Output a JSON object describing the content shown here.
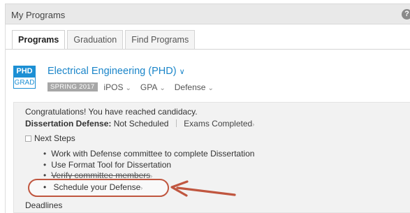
{
  "panel": {
    "title": "My Programs",
    "help_icon": "?"
  },
  "tabs": [
    {
      "label": "Programs",
      "active": true
    },
    {
      "label": "Graduation",
      "active": false
    },
    {
      "label": "Find Programs",
      "active": false
    }
  ],
  "program": {
    "badge_top": "PHD",
    "badge_bottom": "GRAD",
    "title": "Electrical Engineering (PHD)",
    "title_caret": "∨",
    "term": "SPRING 2017",
    "links": [
      "iPOS",
      "GPA",
      "Defense"
    ],
    "link_caret": "⌄"
  },
  "status": {
    "congrats": "Congratulations! You have reached candidacy.",
    "defense_label": "Dissertation Defense:",
    "defense_value": "Not Scheduled",
    "exams": "Exams Completed",
    "next_steps": "Next Steps",
    "steps": [
      "Work with Defense committee to complete Dissertation",
      "Use Format Tool for Dissertation",
      "Verify committee members"
    ],
    "highlighted_step": "Schedule your Defense",
    "deadlines": "Deadlines"
  },
  "colors": {
    "accent_blue": "#1a85c9",
    "annotation_red": "#c0563f",
    "term_badge": "#a7a7a7"
  }
}
